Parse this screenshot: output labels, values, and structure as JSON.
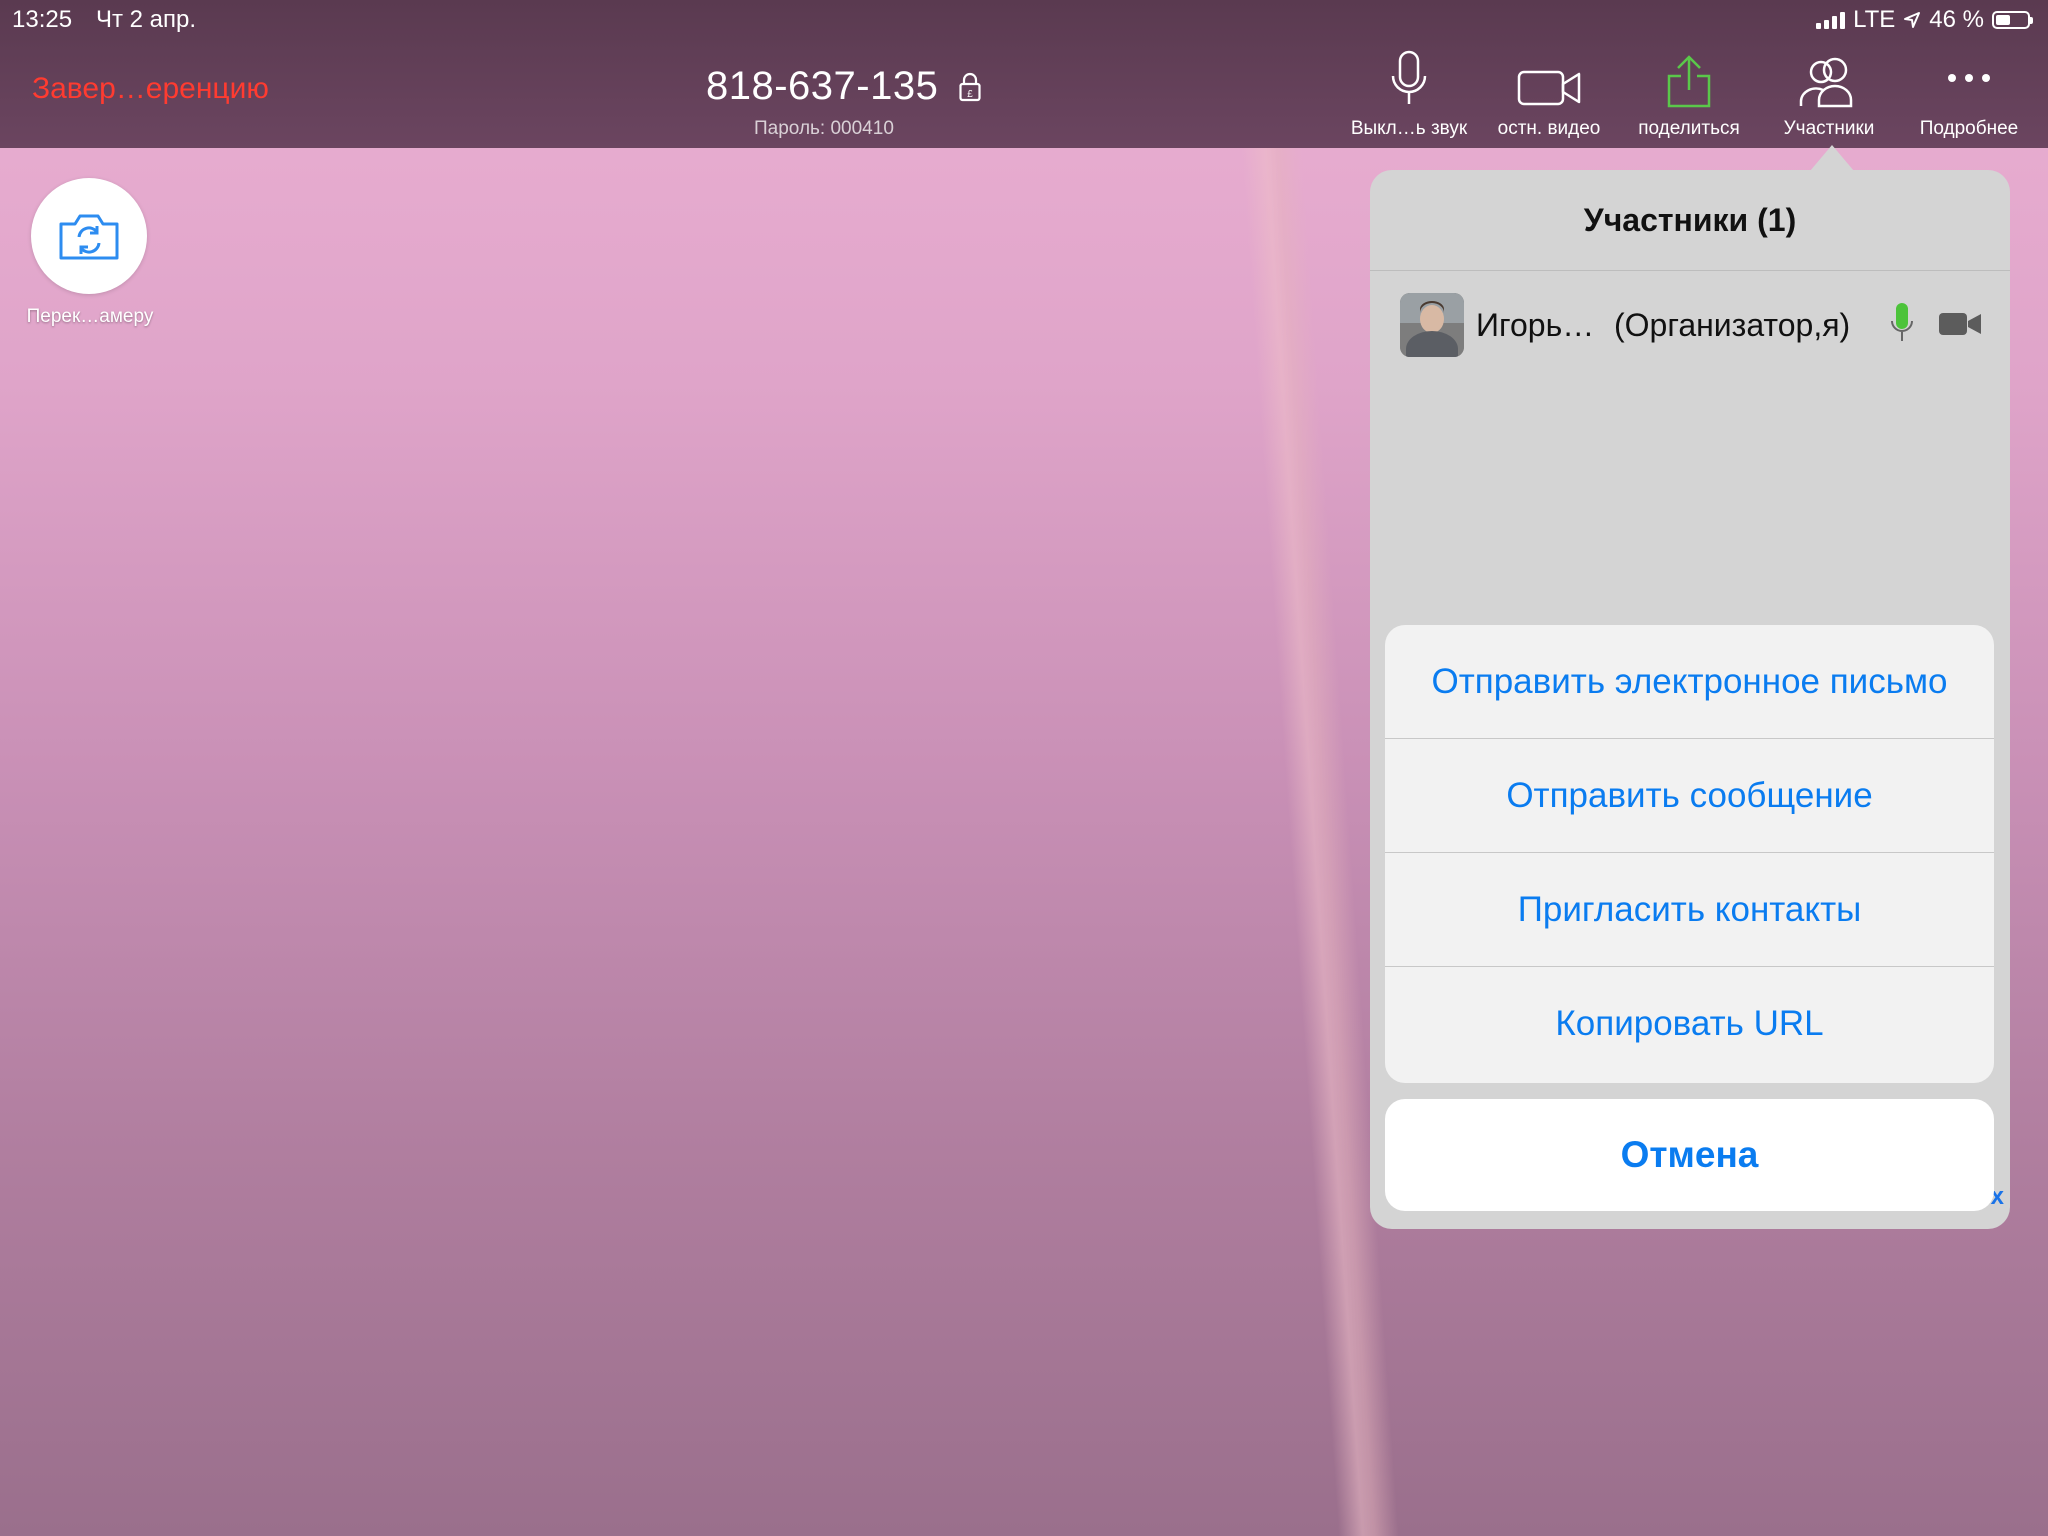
{
  "status_bar": {
    "time": "13:25",
    "date": "Чт 2 апр.",
    "network": "LTE",
    "battery": "46 %",
    "battery_level": 0.46
  },
  "meeting": {
    "end_label": "Завер…еренцию",
    "id": "818-637-135",
    "password": "Пароль: 000410"
  },
  "toolbar": {
    "mute_label": "Выкл…ь звук",
    "stop_video_label": "остн. видео",
    "share_label": "поделиться",
    "participants_label": "Участники",
    "more_label": "Подробнее"
  },
  "switch_camera_label": "Перек…амеру",
  "participants_panel": {
    "title": "Участники (1)",
    "participants": [
      {
        "name": "Игорь…",
        "role": "(Организатор,я)"
      }
    ],
    "close_label": "x"
  },
  "action_sheet": {
    "items": [
      "Отправить электронное письмо",
      "Отправить сообщение",
      "Пригласить контакты",
      "Копировать URL"
    ],
    "cancel_label": "Отмена"
  },
  "colors": {
    "end_red": "#ff3b30",
    "share_green": "#5ac84a",
    "action_blue": "#0a7cf0",
    "mic_green": "#4cc33a"
  }
}
